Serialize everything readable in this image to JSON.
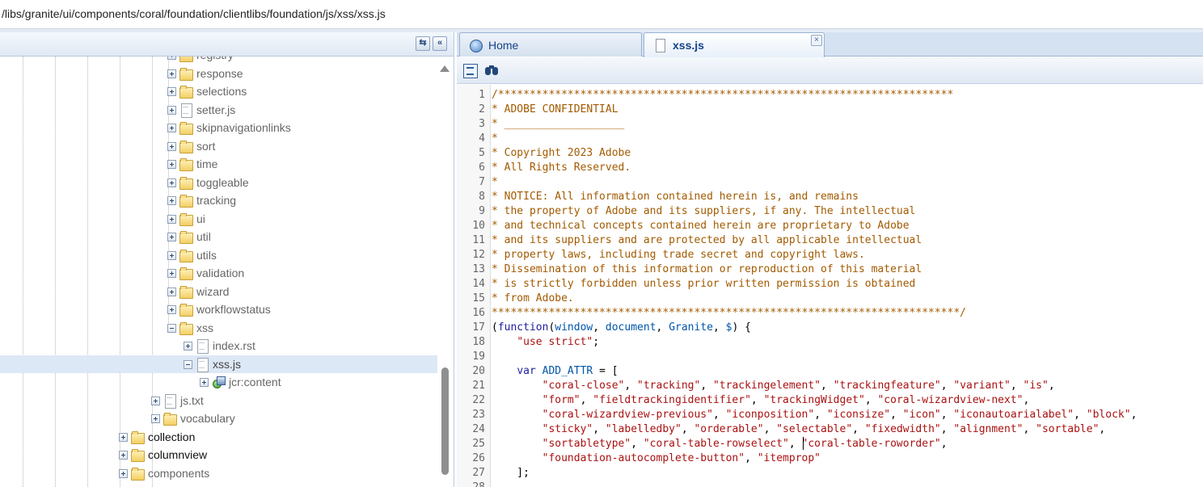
{
  "path_bar": {
    "path": "/libs/granite/ui/components/coral/foundation/clientlibs/foundation/js/xss/xss.js"
  },
  "tree": {
    "header_buttons": {
      "refresh_icon": "refresh-icon",
      "collapse_icon": "collapse-panel-icon",
      "collapse_glyph": "«"
    },
    "items": [
      {
        "label": "registry",
        "type": "folder",
        "depth": 5,
        "expanded": false
      },
      {
        "label": "response",
        "type": "folder",
        "depth": 5,
        "expanded": false
      },
      {
        "label": "selections",
        "type": "folder",
        "depth": 5,
        "expanded": false
      },
      {
        "label": "setter.js",
        "type": "file",
        "depth": 5,
        "expanded": false
      },
      {
        "label": "skipnavigationlinks",
        "type": "folder",
        "depth": 5,
        "expanded": false
      },
      {
        "label": "sort",
        "type": "folder",
        "depth": 5,
        "expanded": false
      },
      {
        "label": "time",
        "type": "folder",
        "depth": 5,
        "expanded": false
      },
      {
        "label": "toggleable",
        "type": "folder",
        "depth": 5,
        "expanded": false
      },
      {
        "label": "tracking",
        "type": "folder",
        "depth": 5,
        "expanded": false
      },
      {
        "label": "ui",
        "type": "folder",
        "depth": 5,
        "expanded": false
      },
      {
        "label": "util",
        "type": "folder",
        "depth": 5,
        "expanded": false
      },
      {
        "label": "utils",
        "type": "folder",
        "depth": 5,
        "expanded": false
      },
      {
        "label": "validation",
        "type": "folder",
        "depth": 5,
        "expanded": false
      },
      {
        "label": "wizard",
        "type": "folder",
        "depth": 5,
        "expanded": false
      },
      {
        "label": "workflowstatus",
        "type": "folder",
        "depth": 5,
        "expanded": false
      },
      {
        "label": "xss",
        "type": "folder",
        "depth": 5,
        "expanded": true
      },
      {
        "label": "index.rst",
        "type": "file",
        "depth": 6,
        "expanded": false
      },
      {
        "label": "xss.js",
        "type": "file",
        "depth": 6,
        "expanded": true,
        "selected": true
      },
      {
        "label": "jcr:content",
        "type": "node",
        "depth": 7,
        "expanded": false
      },
      {
        "label": "js.txt",
        "type": "file",
        "depth": 4,
        "expanded": false
      },
      {
        "label": "vocabulary",
        "type": "folder",
        "depth": 4,
        "expanded": false
      },
      {
        "label": "collection",
        "type": "folder",
        "depth": 2,
        "expanded": false,
        "dark": true
      },
      {
        "label": "columnview",
        "type": "folder",
        "depth": 2,
        "expanded": false,
        "dark": true
      },
      {
        "label": "components",
        "type": "folder",
        "depth": 2,
        "expanded": false
      }
    ]
  },
  "tabs": [
    {
      "label": "Home",
      "icon": "home-icon",
      "active": false
    },
    {
      "label": "xss.js",
      "icon": "document-icon",
      "active": true,
      "close_glyph": "×"
    }
  ],
  "toolbar": {
    "format_icon": "format-code-icon",
    "find_icon": "binoculars-icon"
  },
  "code": {
    "cursor_line": 25,
    "lines": [
      [
        [
          "c-comment",
          "/************************************************************************"
        ]
      ],
      [
        [
          "c-comment",
          "* ADOBE CONFIDENTIAL"
        ]
      ],
      [
        [
          "c-comment",
          "* ___________________"
        ]
      ],
      [
        [
          "c-comment",
          "*"
        ]
      ],
      [
        [
          "c-comment",
          "* Copyright 2023 Adobe"
        ]
      ],
      [
        [
          "c-comment",
          "* All Rights Reserved."
        ]
      ],
      [
        [
          "c-comment",
          "*"
        ]
      ],
      [
        [
          "c-comment",
          "* NOTICE: All information contained herein is, and remains"
        ]
      ],
      [
        [
          "c-comment",
          "* the property of Adobe and its suppliers, if any. The intellectual"
        ]
      ],
      [
        [
          "c-comment",
          "* and technical concepts contained herein are proprietary to Adobe"
        ]
      ],
      [
        [
          "c-comment",
          "* and its suppliers and are protected by all applicable intellectual"
        ]
      ],
      [
        [
          "c-comment",
          "* property laws, including trade secret and copyright laws."
        ]
      ],
      [
        [
          "c-comment",
          "* Dissemination of this information or reproduction of this material"
        ]
      ],
      [
        [
          "c-comment",
          "* is strictly forbidden unless prior written permission is obtained"
        ]
      ],
      [
        [
          "c-comment",
          "* from Adobe."
        ]
      ],
      [
        [
          "c-comment",
          "**************************************************************************/"
        ]
      ],
      [
        [
          "c-plain",
          "("
        ],
        [
          "c-kw",
          "function"
        ],
        [
          "c-plain",
          "("
        ],
        [
          "c-var",
          "window"
        ],
        [
          "c-plain",
          ", "
        ],
        [
          "c-var",
          "document"
        ],
        [
          "c-plain",
          ", "
        ],
        [
          "c-var",
          "Granite"
        ],
        [
          "c-plain",
          ", "
        ],
        [
          "c-var",
          "$"
        ],
        [
          "c-plain",
          ") {"
        ]
      ],
      [
        [
          "c-plain",
          "    "
        ],
        [
          "c-str",
          "\"use strict\""
        ],
        [
          "c-plain",
          ";"
        ]
      ],
      [
        [
          "c-plain",
          ""
        ]
      ],
      [
        [
          "c-plain",
          "    "
        ],
        [
          "c-kw",
          "var"
        ],
        [
          "c-plain",
          " "
        ],
        [
          "c-var",
          "ADD_ATTR"
        ],
        [
          "c-plain",
          " = ["
        ]
      ],
      [
        [
          "c-plain",
          "        "
        ],
        [
          "c-str",
          "\"coral-close\""
        ],
        [
          "c-plain",
          ", "
        ],
        [
          "c-str",
          "\"tracking\""
        ],
        [
          "c-plain",
          ", "
        ],
        [
          "c-str",
          "\"trackingelement\""
        ],
        [
          "c-plain",
          ", "
        ],
        [
          "c-str",
          "\"trackingfeature\""
        ],
        [
          "c-plain",
          ", "
        ],
        [
          "c-str",
          "\"variant\""
        ],
        [
          "c-plain",
          ", "
        ],
        [
          "c-str",
          "\"is\""
        ],
        [
          "c-plain",
          ","
        ]
      ],
      [
        [
          "c-plain",
          "        "
        ],
        [
          "c-str",
          "\"form\""
        ],
        [
          "c-plain",
          ", "
        ],
        [
          "c-str",
          "\"fieldtrackingidentifier\""
        ],
        [
          "c-plain",
          ", "
        ],
        [
          "c-str",
          "\"trackingWidget\""
        ],
        [
          "c-plain",
          ", "
        ],
        [
          "c-str",
          "\"coral-wizardview-next\""
        ],
        [
          "c-plain",
          ","
        ]
      ],
      [
        [
          "c-plain",
          "        "
        ],
        [
          "c-str",
          "\"coral-wizardview-previous\""
        ],
        [
          "c-plain",
          ", "
        ],
        [
          "c-str",
          "\"iconposition\""
        ],
        [
          "c-plain",
          ", "
        ],
        [
          "c-str",
          "\"iconsize\""
        ],
        [
          "c-plain",
          ", "
        ],
        [
          "c-str",
          "\"icon\""
        ],
        [
          "c-plain",
          ", "
        ],
        [
          "c-str",
          "\"iconautoarialabel\""
        ],
        [
          "c-plain",
          ", "
        ],
        [
          "c-str",
          "\"block\""
        ],
        [
          "c-plain",
          ","
        ]
      ],
      [
        [
          "c-plain",
          "        "
        ],
        [
          "c-str",
          "\"sticky\""
        ],
        [
          "c-plain",
          ", "
        ],
        [
          "c-str",
          "\"labelledby\""
        ],
        [
          "c-plain",
          ", "
        ],
        [
          "c-str",
          "\"orderable\""
        ],
        [
          "c-plain",
          ", "
        ],
        [
          "c-str",
          "\"selectable\""
        ],
        [
          "c-plain",
          ", "
        ],
        [
          "c-str",
          "\"fixedwidth\""
        ],
        [
          "c-plain",
          ", "
        ],
        [
          "c-str",
          "\"alignment\""
        ],
        [
          "c-plain",
          ", "
        ],
        [
          "c-str",
          "\"sortable\""
        ],
        [
          "c-plain",
          ","
        ]
      ],
      [
        [
          "c-plain",
          "        "
        ],
        [
          "c-str",
          "\"sortabletype\""
        ],
        [
          "c-plain",
          ", "
        ],
        [
          "c-str",
          "\"coral-table-rowselect\""
        ],
        [
          "c-plain",
          ", "
        ],
        [
          "c-str",
          "\"coral-table-roworder\""
        ],
        [
          "c-plain",
          ","
        ]
      ],
      [
        [
          "c-plain",
          "        "
        ],
        [
          "c-str",
          "\"foundation-autocomplete-button\""
        ],
        [
          "c-plain",
          ", "
        ],
        [
          "c-str",
          "\"itemprop\""
        ]
      ],
      [
        [
          "c-plain",
          "    ];"
        ]
      ],
      [
        [
          "c-plain",
          ""
        ]
      ]
    ]
  }
}
